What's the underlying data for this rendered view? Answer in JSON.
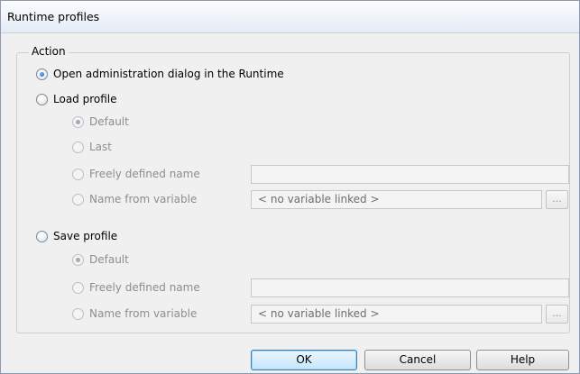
{
  "window": {
    "title": "Runtime profiles"
  },
  "group": {
    "legend": "Action"
  },
  "options": {
    "open_admin": {
      "label": "Open administration dialog in the Runtime"
    },
    "load_profile": {
      "label": "Load profile",
      "default_label": "Default",
      "last_label": "Last",
      "freely_label": "Freely defined name",
      "freely_value": "",
      "variable_label": "Name from variable",
      "variable_value": "< no variable linked >",
      "browse_label": "..."
    },
    "save_profile": {
      "label": "Save profile",
      "default_label": "Default",
      "freely_label": "Freely defined name",
      "freely_value": "",
      "variable_label": "Name from variable",
      "variable_value": "< no variable linked >",
      "browse_label": "..."
    }
  },
  "buttons": {
    "ok": "OK",
    "cancel": "Cancel",
    "help": "Help"
  }
}
